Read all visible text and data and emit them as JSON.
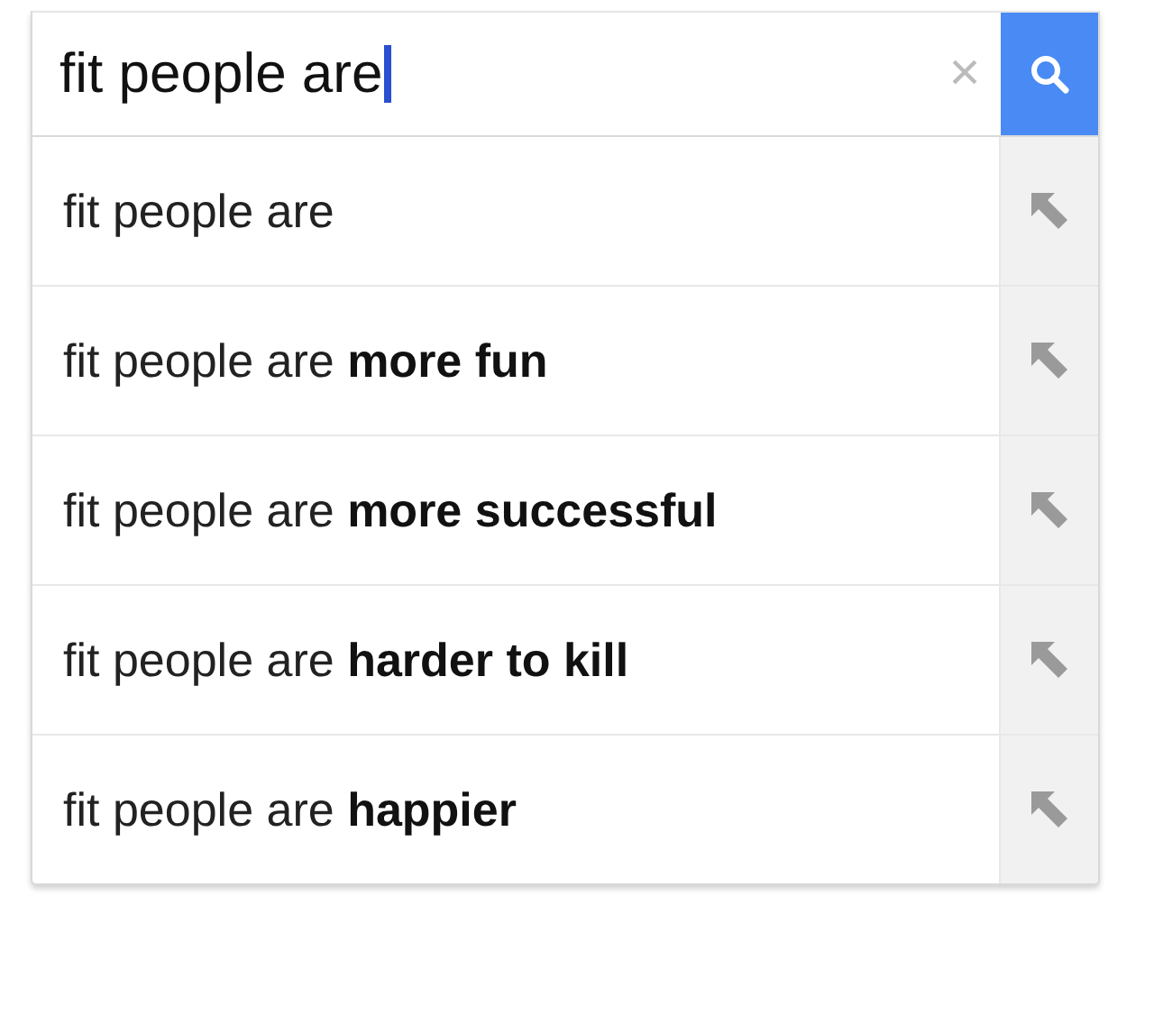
{
  "search": {
    "value": "fit people are",
    "clear": "×"
  },
  "suggestions": [
    {
      "text": "fit people are"
    },
    {
      "text": "fit people are **more fun**"
    },
    {
      "text": "fit people are **more successful**"
    },
    {
      "text": "fit people are **harder to kill**"
    },
    {
      "text": "fit people are **happier**"
    }
  ]
}
